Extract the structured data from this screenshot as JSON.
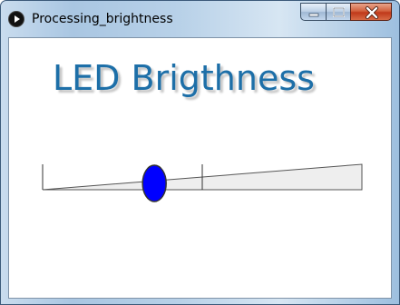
{
  "window": {
    "title": "Processing_brightness",
    "icon": "processing-play-icon",
    "controls": [
      "minimize-icon",
      "maximize-icon",
      "close-icon"
    ]
  },
  "content": {
    "heading": "LED Brigthness",
    "heading_color": "#1d6fa8"
  },
  "slider": {
    "value_fraction": 0.35,
    "knob_color": "#0000ff",
    "track_fill": "#eeeeee",
    "marker_fraction": 0.5
  }
}
